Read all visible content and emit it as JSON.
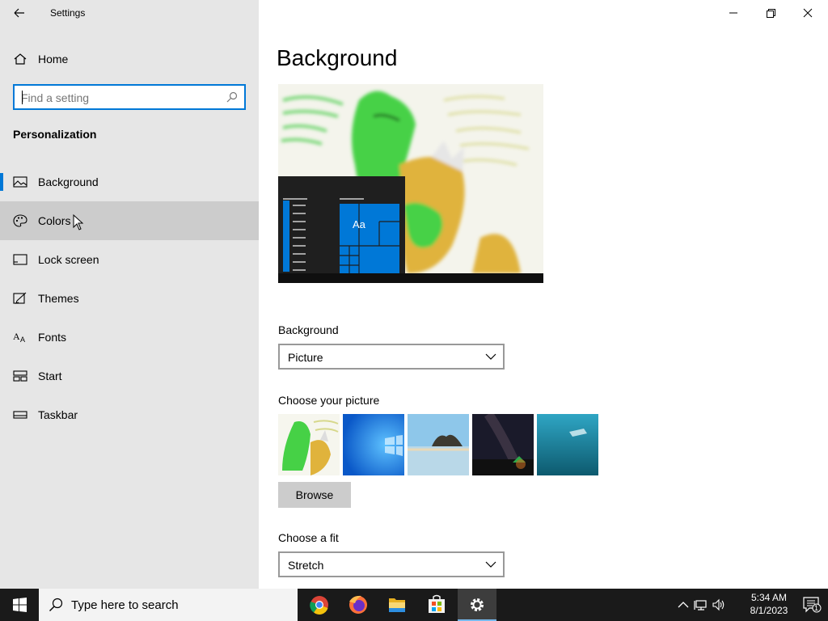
{
  "window": {
    "title": "Settings"
  },
  "sidebar": {
    "home_label": "Home",
    "search_placeholder": "Find a setting",
    "section_title": "Personalization",
    "items": [
      {
        "label": "Background",
        "icon": "picture-icon",
        "selected": true
      },
      {
        "label": "Colors",
        "icon": "palette-icon",
        "hover": true
      },
      {
        "label": "Lock screen",
        "icon": "lock-screen-icon"
      },
      {
        "label": "Themes",
        "icon": "themes-icon"
      },
      {
        "label": "Fonts",
        "icon": "fonts-icon"
      },
      {
        "label": "Start",
        "icon": "start-icon"
      },
      {
        "label": "Taskbar",
        "icon": "taskbar-icon"
      }
    ]
  },
  "main": {
    "page_title": "Background",
    "preview_tile_text": "Aa",
    "background_label": "Background",
    "background_value": "Picture",
    "choose_picture_label": "Choose your picture",
    "browse_label": "Browse",
    "fit_label": "Choose a fit",
    "fit_value": "Stretch"
  },
  "taskbar": {
    "search_text": "Type here to search",
    "apps": [
      "chrome-icon",
      "firefox-icon",
      "file-explorer-icon",
      "store-icon",
      "settings-icon"
    ],
    "time": "5:34 AM",
    "date": "8/1/2023",
    "notification_count": "1"
  },
  "colors": {
    "accent": "#0078d7",
    "sidebar_bg": "#e6e6e6",
    "hover_bg": "#cccccc",
    "taskbar_bg": "#1a1a1a"
  }
}
